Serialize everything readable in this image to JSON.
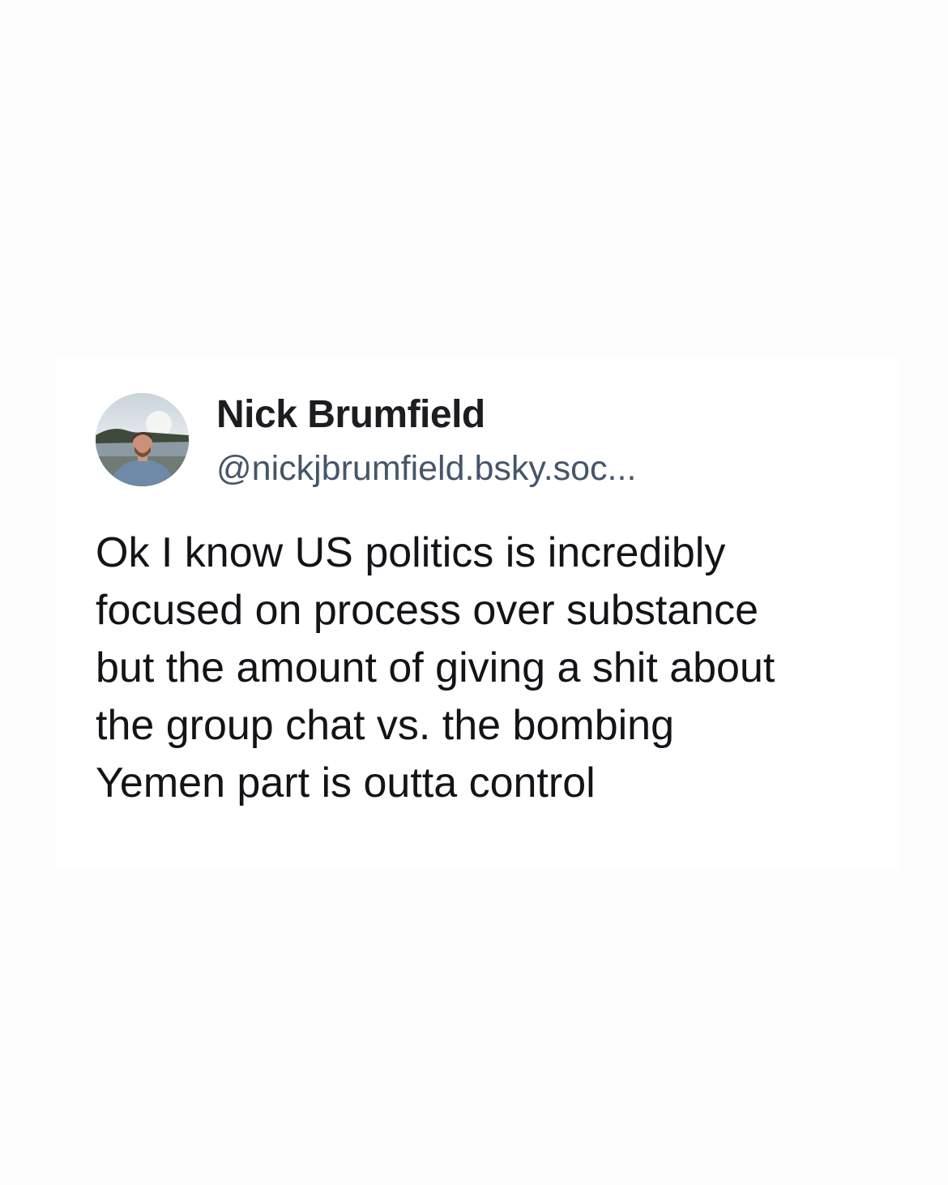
{
  "post": {
    "author": {
      "display_name": "Nick Brumfield",
      "handle": "@nickjbrumfield.bsky.soc..."
    },
    "text": "Ok I know US politics is incredibly\nfocused on process over substance\nbut the amount of giving a shit about\nthe group chat vs. the bombing\nYemen part is outta control"
  },
  "colors": {
    "background": "#fdfdfd",
    "name": "#1b1d21",
    "handle": "#465669",
    "text": "#121417"
  }
}
